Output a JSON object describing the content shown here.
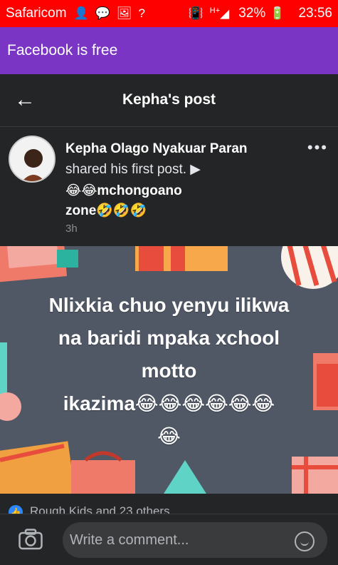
{
  "status_bar": {
    "carrier": "Safaricom",
    "icons": [
      "person-icon",
      "chat-icon",
      "image-icon",
      "no-signal-icon",
      "vibrate-icon",
      "signal-icon",
      "battery-icon"
    ],
    "signal_label": "H+",
    "battery_percent": "32%",
    "time": "23:56",
    "background_color": "#ff0000"
  },
  "promo": {
    "text": "Facebook is free",
    "color": "#7b35c4"
  },
  "header": {
    "title": "Kepha's post"
  },
  "post": {
    "author": "Kepha Olago Nyakuar Paran",
    "action": "shared his first post. ▶",
    "tag_line1": "😂😂mchongoano",
    "tag_line2": "zone🤣🤣🤣",
    "time": "3h",
    "text_line1": "Nlixkia chuo yenyu ilikwa",
    "text_line2": "na baridi mpaka xchool",
    "text_line3": "motto",
    "text_line4": "ikazima😂😂😂😂😂😂",
    "text_line5": "😂"
  },
  "reactions": {
    "text": "Rough Kids and 23 others"
  },
  "comment": {
    "placeholder": "Write a comment..."
  }
}
